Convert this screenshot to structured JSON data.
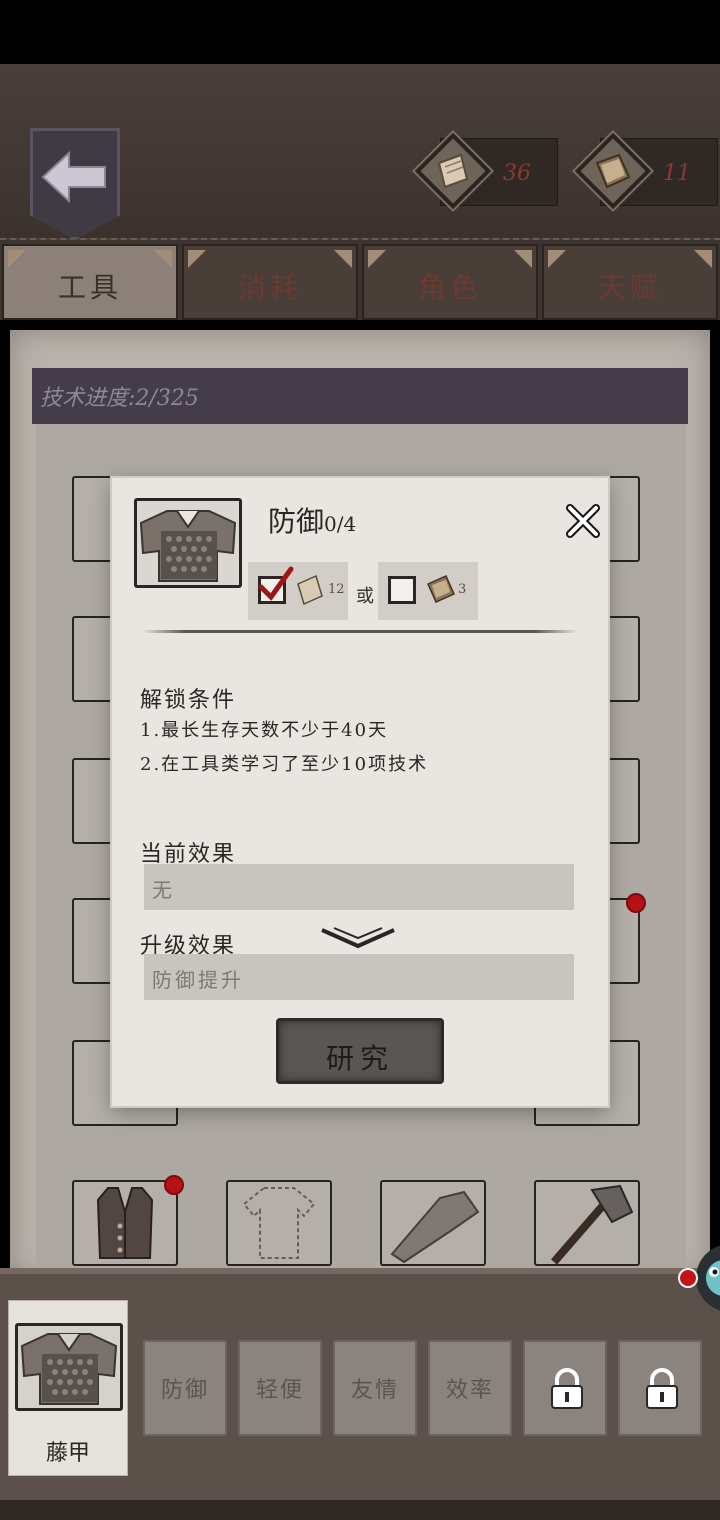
{
  "tabs": [
    {
      "label": "工具",
      "active": true
    },
    {
      "label": "消耗",
      "active": false
    },
    {
      "label": "角色",
      "active": false
    },
    {
      "label": "天赋",
      "active": false
    }
  ],
  "resources": {
    "paper_count": "36",
    "book_count": "11"
  },
  "board": {
    "progress_label": "技术进度:2/325"
  },
  "modal": {
    "title": "防御",
    "level": "0/4",
    "cost_option1_count": "12",
    "cost_option1_checked": true,
    "or_label": "或",
    "cost_option2_count": "3",
    "cost_option2_checked": false,
    "unlock_title": "解锁条件",
    "conditions": [
      "1.最长生存天数不少于40天",
      "2.在工具类学习了至少10项技术"
    ],
    "current_effect_title": "当前效果",
    "current_effect_value": "无",
    "upgrade_effect_title": "升级效果",
    "upgrade_effect_value": "防御提升",
    "research_button": "研究"
  },
  "bottom": {
    "item_name": "藤甲",
    "options": [
      "防御",
      "轻便",
      "友情",
      "效率"
    ],
    "locked_count": 2
  },
  "colors": {
    "accent_red": "#c4141a",
    "tab_text": "#6b3a33",
    "panel_bg": "#e9e6e1"
  }
}
